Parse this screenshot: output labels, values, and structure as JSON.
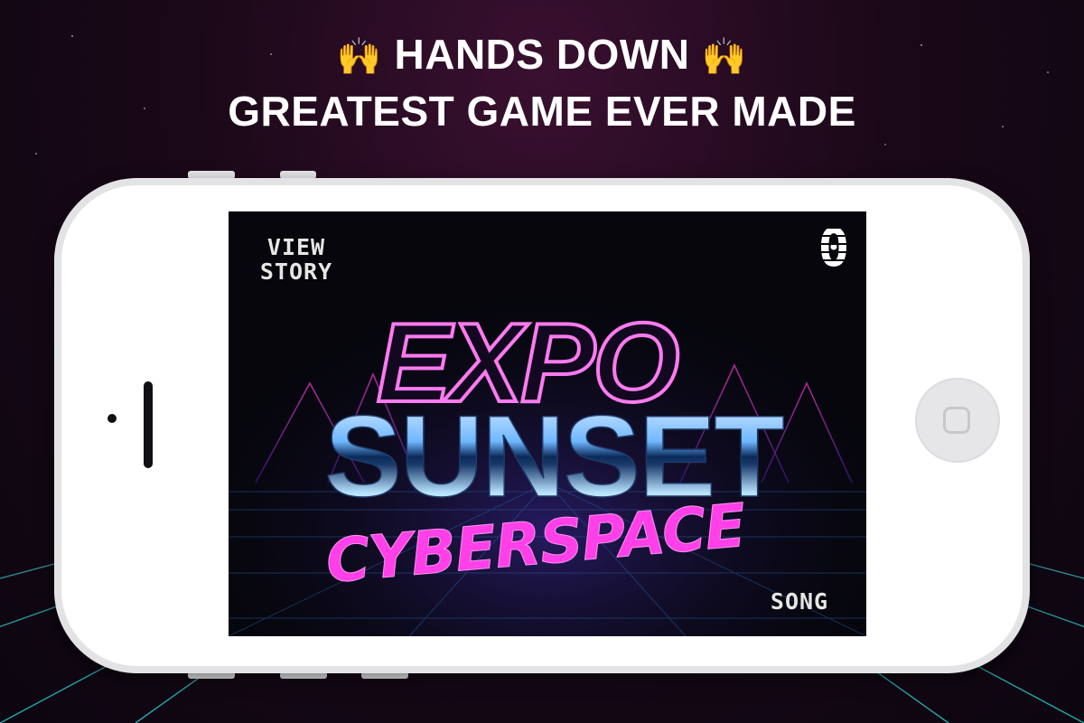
{
  "promo": {
    "emoji_left": "🙌",
    "line1": "HANDS DOWN",
    "emoji_right": "🙌",
    "line2": "GREATEST GAME EVER MADE"
  },
  "game": {
    "title_expo": "EXPO",
    "title_sunset": "SUNSET",
    "title_cyberspace": "CYBERSPACE",
    "view_story_line1": "VIEW",
    "view_story_line2": "STORY",
    "song_label": "SONG",
    "score": "0"
  },
  "colors": {
    "neon_pink": "#ff44e0",
    "neon_cyan": "#1ee8e0",
    "phone_body": "#ffffff"
  }
}
